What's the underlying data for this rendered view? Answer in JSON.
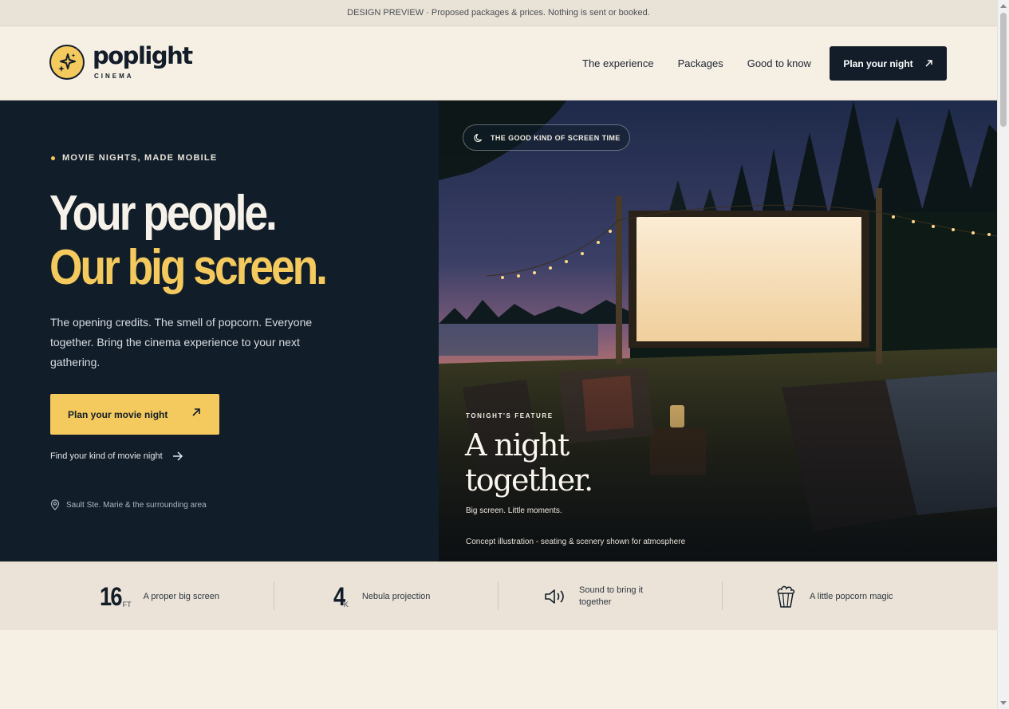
{
  "banner": {
    "text": "DESIGN PREVIEW · Proposed packages & prices. Nothing is sent or booked."
  },
  "header": {
    "logo_word": "poplight",
    "logo_sub": "CINEMA",
    "nav": [
      "The experience",
      "Packages",
      "Good to know"
    ],
    "cta_label": "Plan your night"
  },
  "hero": {
    "eyebrow": "MOVIE NIGHTS, MADE MOBILE",
    "headline_line1": "Your people.",
    "headline_line2": "Our big screen.",
    "body": "The opening credits. The smell of popcorn. Everyone together. Bring the cinema experience to your next gathering.",
    "cta_label": "Plan your movie night",
    "secondary_link": "Find your kind of movie night",
    "location": "Sault Ste. Marie & the surrounding area"
  },
  "feature": {
    "pill": "THE GOOD KIND OF SCREEN TIME",
    "kicker": "TONIGHT'S FEATURE",
    "title_line1": "A night",
    "title_line2": "together.",
    "subtitle": "Big screen. Little moments.",
    "note": "Concept illustration - seating & scenery shown for atmosphere"
  },
  "stats": [
    {
      "number": "16",
      "unit": "FT",
      "label": "A proper big screen"
    },
    {
      "number": "4",
      "unit": "K",
      "label": "Nebula projection"
    },
    {
      "icon": "speaker-icon",
      "label_line1": "Sound to bring it",
      "label_line2": "together"
    },
    {
      "icon": "popcorn-icon",
      "label": "A little popcorn magic"
    }
  ],
  "colors": {
    "navy": "#111d29",
    "accent_yellow": "#f4c95d",
    "cream": "#f6efe4",
    "stats_bg": "#ebe3d7"
  }
}
